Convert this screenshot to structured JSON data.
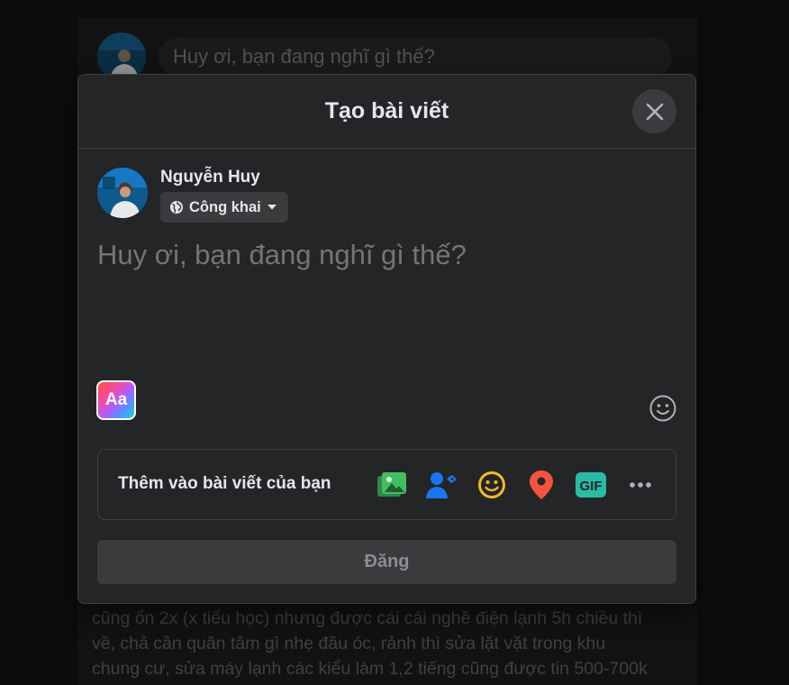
{
  "background": {
    "composer_placeholder": "Huy ơi, bạn đang nghĩ gì thế?",
    "post_lines": [
      "cũng ổn 2x (x tiểu học) nhưng được cái cái nghề điện lạnh 5h chiều thì",
      "về, chả cần quân tâm gì nhẹ đầu óc, rảnh thì sửa lặt vặt trong khu",
      "chung cư, sửa máy lạnh các kiểu làm 1,2 tiếng cũng được tin 500-700k"
    ]
  },
  "modal": {
    "title": "Tạo bài viết",
    "user": {
      "name": "Nguyễn Huy",
      "privacy": "Công khai"
    },
    "composer": {
      "placeholder": "Huy ơi, bạn đang nghĩ gì thế?"
    },
    "bg_style_label": "Aa",
    "add_to_post": {
      "label": "Thêm vào bài viết của bạn",
      "tools": [
        {
          "name": "photo-video-icon",
          "color": "#45bd62"
        },
        {
          "name": "tag-people-icon",
          "color": "#1877f2"
        },
        {
          "name": "feeling-icon",
          "color": "#f7b928"
        },
        {
          "name": "check-in-icon",
          "color": "#f5533d"
        },
        {
          "name": "gif-icon",
          "color": "#2abba7",
          "text": "GIF"
        },
        {
          "name": "more-icon",
          "color": "#b0b3b8"
        }
      ]
    },
    "submit_label": "Đăng"
  }
}
